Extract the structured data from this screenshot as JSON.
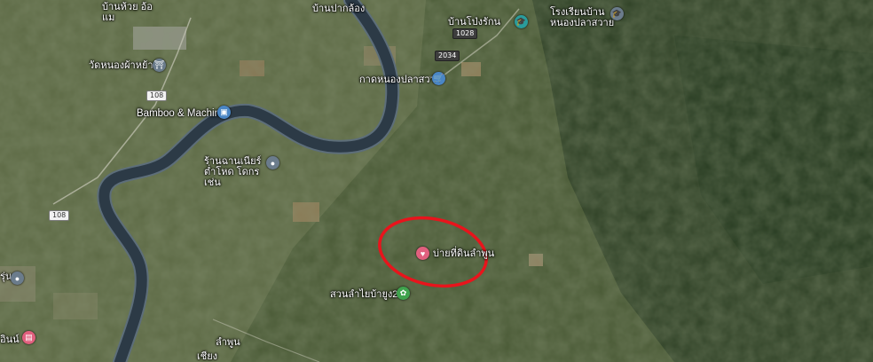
{
  "colors": {
    "river": "#2c3a46",
    "river_edge": "#5d6e7a",
    "annotation": "#e8141c",
    "pin_blue": "#4a86c5",
    "pin_grey": "#6b7c8c",
    "pin_green": "#3fa34d",
    "pin_pink": "#e0607e",
    "pin_teal": "#2a9c9c"
  },
  "labels": {
    "village_top_left": "บ้านห้วย อ้อแม",
    "village_top": "บ้านปากล้อง",
    "school_top": "บ้านโป่งรักน",
    "school_right": "โรงเรียนบ้าน หนองปลาสวาย",
    "temple": "วัดหนองผ้าหย้าง",
    "market": "กาดหนองปลาสวาย",
    "bamboo": "Bamboo & Machine",
    "restaurant": "ร้านฉานเนียร์ ต่ำโหด โดกรเช่น",
    "marked_place": "บ่ายที่ดินลำพูน",
    "garden": "สวนลำไยบ้ายูง2",
    "left_edge": "รุ่น",
    "bottom_left": "อินน์",
    "bottom_road": "ลำพูน",
    "bottom_road2": "เชียง"
  },
  "roads": {
    "route_108_a": "108",
    "route_108_b": "108",
    "route_1028": "1028",
    "route_2034": "2034"
  },
  "icons": {
    "temple": "temple-icon",
    "market": "shopping-cart-icon",
    "bamboo": "store-icon",
    "restaurant": "location-pin-icon",
    "marked_place": "heart-icon",
    "garden": "park-icon",
    "school_top": "school-icon",
    "school_right": "school-icon",
    "bottom_left": "lodging-icon",
    "left_edge": "location-pin-icon"
  }
}
